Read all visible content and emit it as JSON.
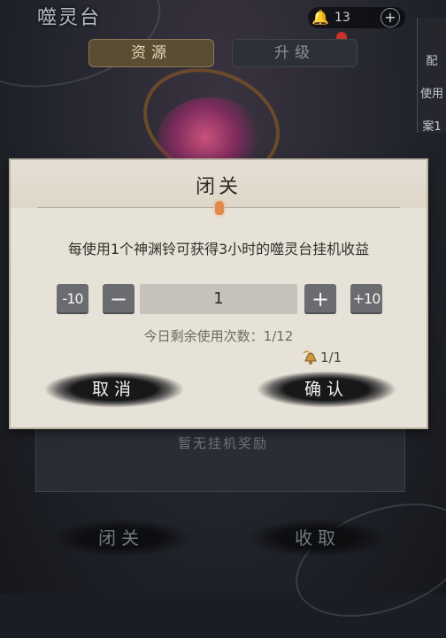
{
  "header": {
    "title": "噬灵台",
    "currency_count": "13",
    "plus_label": "+"
  },
  "tabs": [
    {
      "label": "资源",
      "active": true
    },
    {
      "label": "升级",
      "active": false
    }
  ],
  "side_panel": {
    "line1": "配",
    "line2": "使用",
    "line3": "案1"
  },
  "background_panel": {
    "empty_text": "暂无挂机奖励",
    "retreat_button": "闭关",
    "collect_button": "收取"
  },
  "dialog": {
    "title": "闭关",
    "description": "每使用1个神渊铃可获得3小时的噬灵台挂机收益",
    "minus10_label": "-10",
    "minus1_label": "−",
    "plus1_label": "+",
    "plus10_label": "+10",
    "quantity": "1",
    "remaining_label": "今日剩余使用次数：",
    "remaining_value": "1/12",
    "cost_value": "1/1",
    "cancel_label": "取消",
    "confirm_label": "确认"
  },
  "colors": {
    "dialog_bg": "#e7e2d8",
    "stepper_bg": "#6a6c70",
    "accent_ornament": "#e28a4e",
    "ink_button": "#17181a"
  },
  "icons": [
    "bell-currency-icon",
    "plus-circle-icon",
    "red-dot-notification-icon",
    "bell-cost-icon"
  ]
}
